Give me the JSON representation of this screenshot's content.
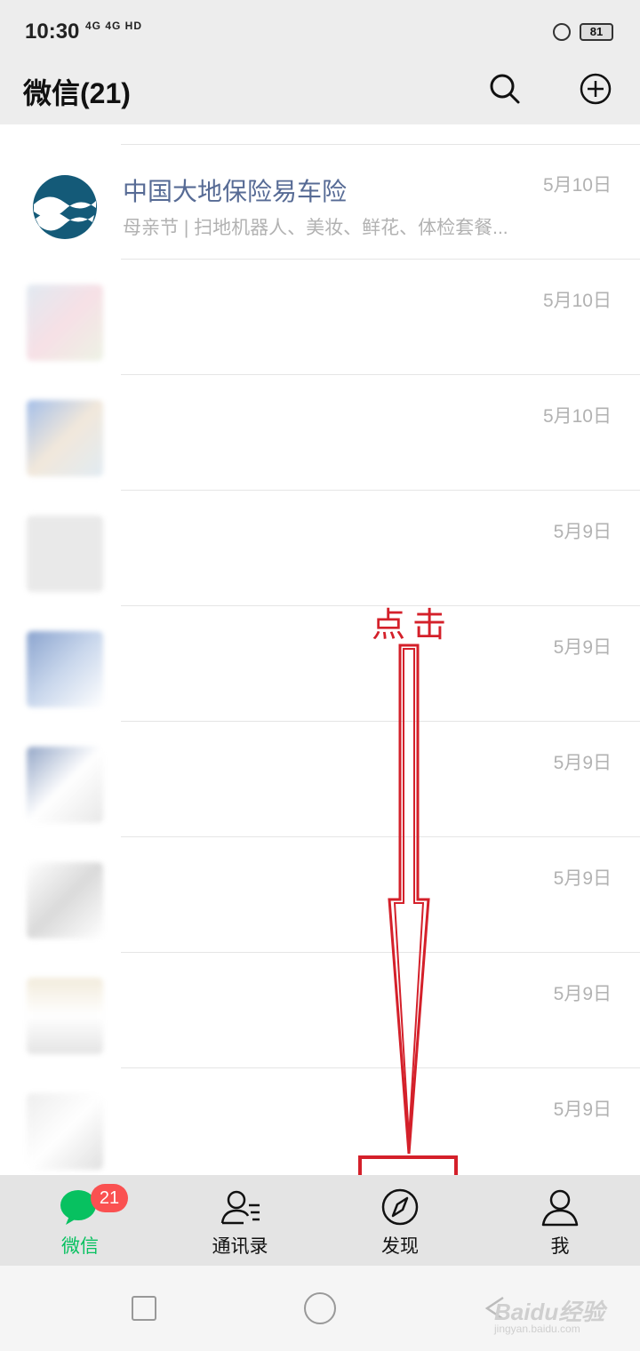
{
  "status": {
    "time": "10:30",
    "network": "4G 4G HD",
    "battery": "81"
  },
  "header": {
    "title": "微信(21)",
    "search_icon": "search-icon",
    "add_icon": "plus-circle-icon"
  },
  "chats": [
    {
      "name": "中国大地保险易车险",
      "preview": "母亲节 | 扫地机器人、美妆、鲜花、体检套餐...",
      "time": "5月10日"
    },
    {
      "name": "",
      "preview": "",
      "time": "5月10日"
    },
    {
      "name": "",
      "preview": "",
      "time": "5月10日"
    },
    {
      "name": "",
      "preview": "",
      "time": "5月9日"
    },
    {
      "name": "",
      "preview": "",
      "time": "5月9日"
    },
    {
      "name": "",
      "preview": "",
      "time": "5月9日"
    },
    {
      "name": "",
      "preview": "",
      "time": "5月9日"
    },
    {
      "name": "",
      "preview": "",
      "time": "5月9日"
    },
    {
      "name": "",
      "preview": "",
      "time": "5月9日"
    }
  ],
  "annotation": {
    "text": "点击",
    "color": "#d4202a"
  },
  "tabs": [
    {
      "label": "微信",
      "badge": "21",
      "icon": "chat-bubble-icon",
      "active": true
    },
    {
      "label": "通讯录",
      "icon": "contacts-icon"
    },
    {
      "label": "发现",
      "icon": "compass-icon"
    },
    {
      "label": "我",
      "icon": "person-icon"
    }
  ],
  "watermark": {
    "text": "Baidu经验",
    "sub": "jingyan.baidu.com"
  },
  "colors": {
    "accent": "#07c160",
    "badge": "#fa5151",
    "link": "#576b95"
  }
}
